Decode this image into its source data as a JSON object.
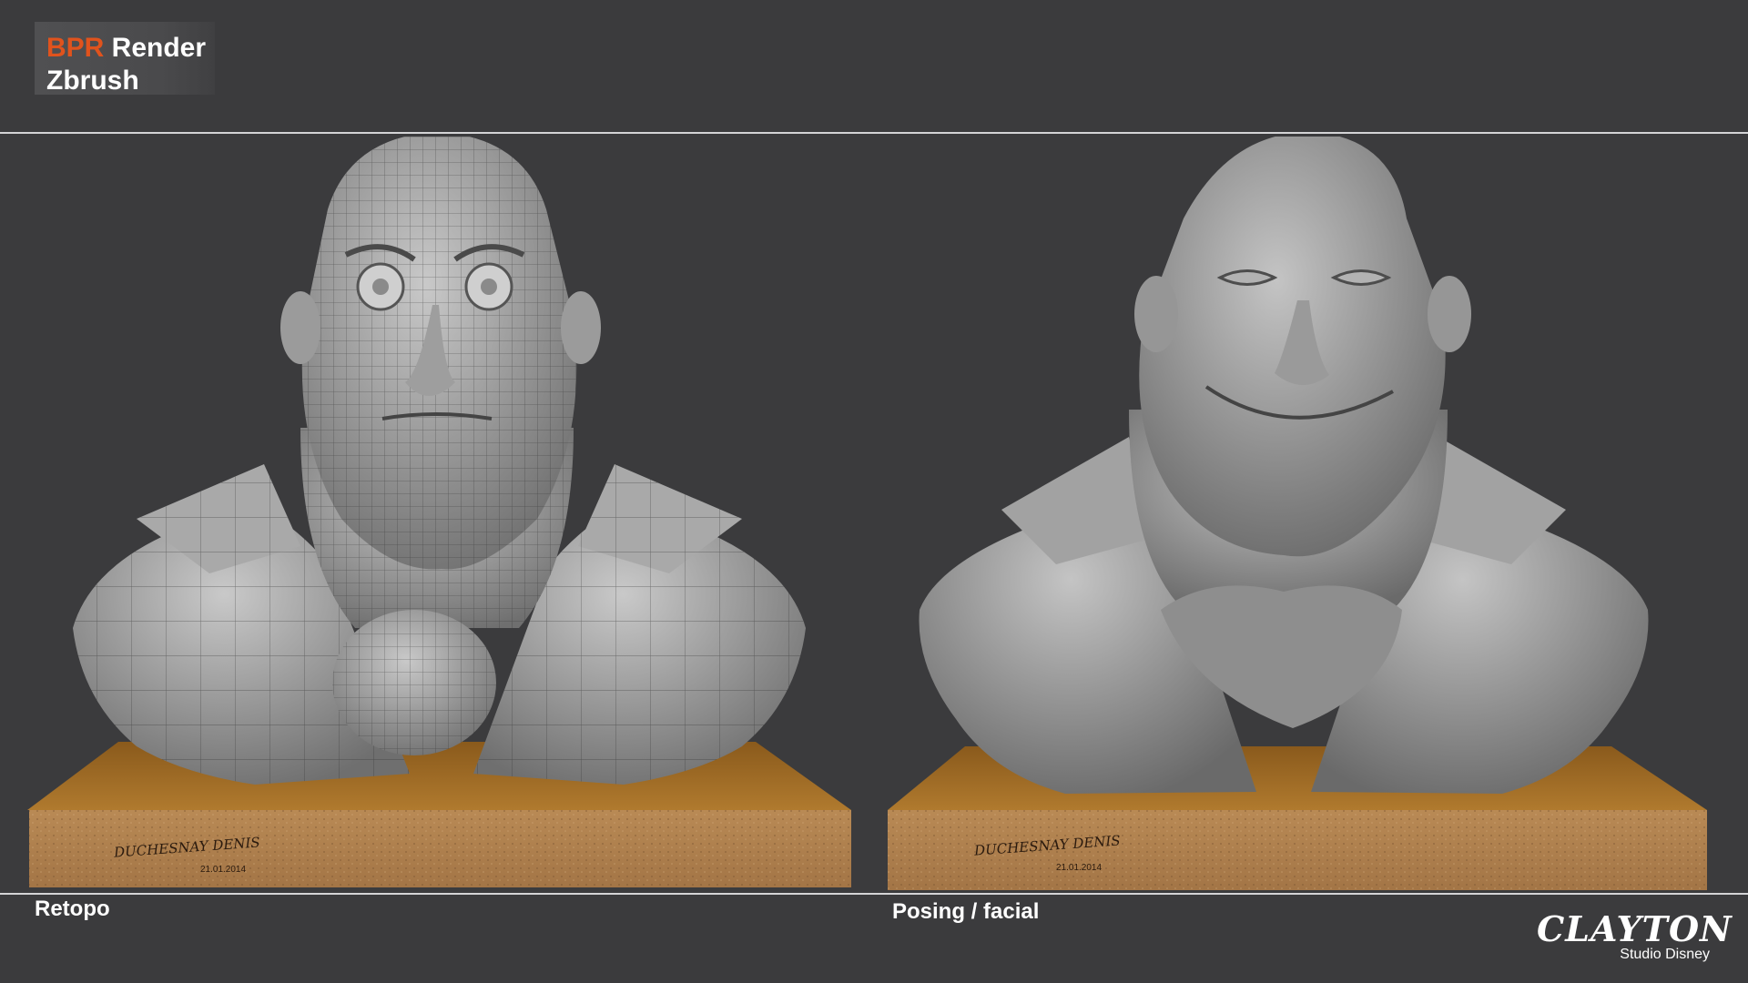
{
  "header": {
    "title_accent": "BPR",
    "title_rest": " Render",
    "subtitle": "Zbrush",
    "accent_color": "#e0531d"
  },
  "panels": [
    {
      "caption": "Retopo",
      "signature": "DUCHESNAY DENIS",
      "date": "21.01.2014",
      "style": "wireframe"
    },
    {
      "caption": "Posing / facial",
      "signature": "DUCHESNAY DENIS",
      "date": "21.01.2014",
      "style": "smooth"
    }
  ],
  "logo": {
    "word": "CLAYTON",
    "subtitle": "Studio Disney"
  }
}
